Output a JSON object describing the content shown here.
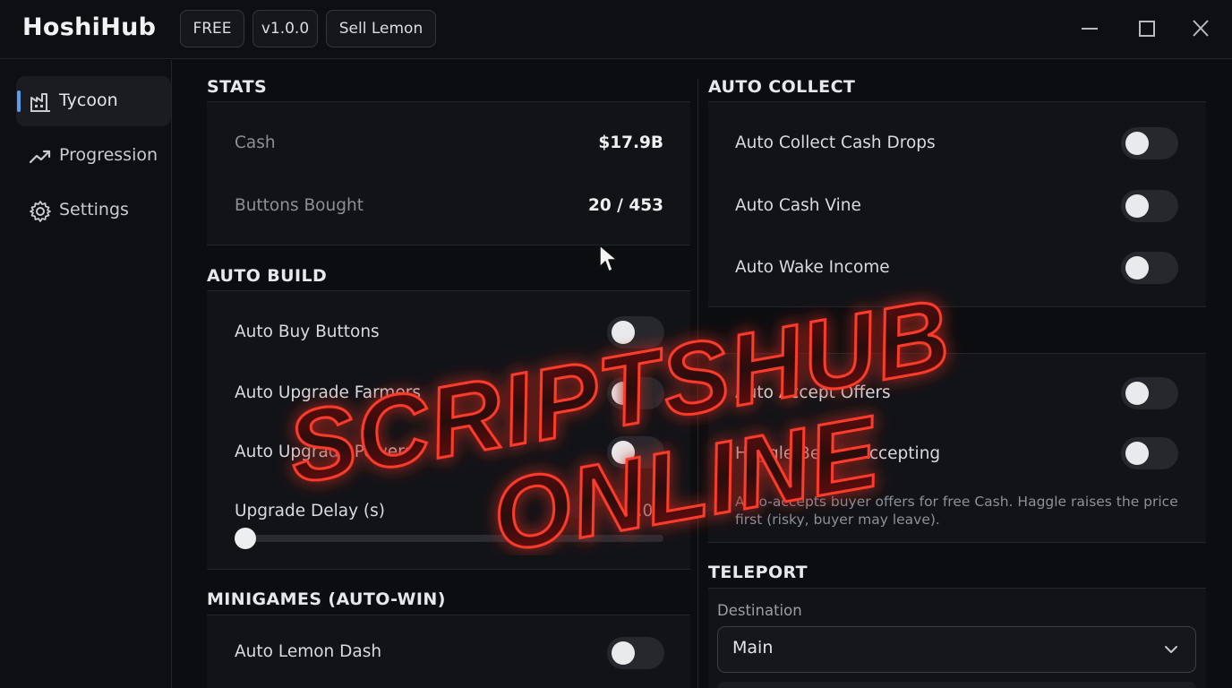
{
  "app": {
    "title": "HoshiHub",
    "chips": [
      "FREE",
      "v1.0.0",
      "Sell Lemon"
    ]
  },
  "sidebar": {
    "items": [
      {
        "label": "Tycoon",
        "icon": "factory-icon",
        "active": true
      },
      {
        "label": "Progression",
        "icon": "trending-up-icon",
        "active": false
      },
      {
        "label": "Settings",
        "icon": "gear-icon",
        "active": false
      }
    ]
  },
  "stats": {
    "title": "STATS",
    "rows": [
      {
        "label": "Cash",
        "value": "$17.9B"
      },
      {
        "label": "Buttons Bought",
        "value": "20 / 453"
      }
    ]
  },
  "auto_build": {
    "title": "AUTO BUILD",
    "toggles": [
      {
        "label": "Auto Buy Buttons",
        "on": false
      },
      {
        "label": "Auto Upgrade Farmers",
        "on": false
      },
      {
        "label": "Auto Upgrade Powers",
        "on": false
      }
    ],
    "slider": {
      "label": "Upgrade Delay (s)",
      "value": "0.03",
      "fraction": 0.02
    }
  },
  "minigames": {
    "title": "MINIGAMES (AUTO-WIN)",
    "toggles": [
      {
        "label": "Auto Lemon Dash",
        "on": false
      }
    ]
  },
  "auto_collect": {
    "title": "AUTO COLLECT",
    "toggles": [
      {
        "label": "Auto Collect Cash Drops",
        "on": false
      },
      {
        "label": "Auto Cash Vine",
        "on": false
      },
      {
        "label": "Auto Wake Income",
        "on": false
      }
    ]
  },
  "offers": {
    "toggles": [
      {
        "label": "Auto Accept Offers",
        "on": false
      },
      {
        "label": "Haggle Before Accepting",
        "on": false
      }
    ],
    "help": "Auto-accepts buyer offers for free Cash. Haggle raises the price first (risky, buyer may leave)."
  },
  "teleport": {
    "title": "TELEPORT",
    "destination_label": "Destination",
    "destination_value": "Main"
  },
  "watermark": {
    "line1": "SCRIPTSHUB",
    "line2": "ONLINE"
  }
}
